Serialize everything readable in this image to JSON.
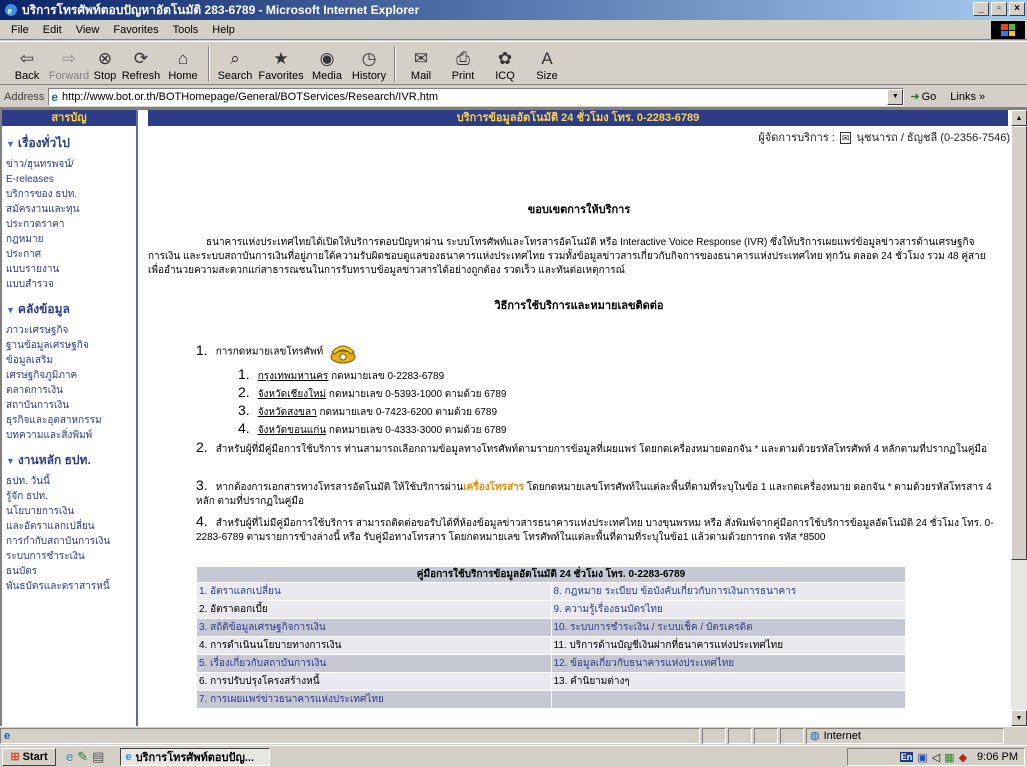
{
  "window": {
    "title": "บริการโทรศัพท์ตอบปัญหาอัตโนมัติ 283-6789 - Microsoft Internet Explorer"
  },
  "menu": [
    "File",
    "Edit",
    "View",
    "Favorites",
    "Tools",
    "Help"
  ],
  "toolbar": [
    {
      "label": "Back",
      "icon": "back-arrow-icon"
    },
    {
      "label": "Forward",
      "icon": "forward-arrow-icon"
    },
    {
      "label": "Stop",
      "icon": "stop-icon"
    },
    {
      "label": "Refresh",
      "icon": "refresh-icon"
    },
    {
      "label": "Home",
      "icon": "home-icon"
    },
    {
      "label": "Search",
      "icon": "search-icon"
    },
    {
      "label": "Favorites",
      "icon": "favorites-icon"
    },
    {
      "label": "Media",
      "icon": "media-icon"
    },
    {
      "label": "History",
      "icon": "history-icon"
    },
    {
      "label": "Mail",
      "icon": "mail-icon"
    },
    {
      "label": "Print",
      "icon": "print-icon"
    },
    {
      "label": "ICQ",
      "icon": "icq-icon"
    },
    {
      "label": "Size",
      "icon": "size-icon"
    }
  ],
  "address": {
    "label": "Address",
    "url": "http://www.bot.or.th/BOTHomepage/General/BOTServices/Research/IVR.htm",
    "go": "Go",
    "links": "Links »"
  },
  "sidebar": {
    "header": "สารบัญ",
    "sections": [
      {
        "title": "เรื่องทั่วไป",
        "items": [
          "ข่าว/ฮุนทรพจน์/",
          "E-releases",
          "บริการของ ธปท.",
          "สมัครงานและทุน",
          "ประกวดราคา",
          "กฎหมาย",
          "ประกาศ",
          "แบบรายงาน",
          "แบบสำรวจ"
        ]
      },
      {
        "title": "คลังข้อมูล",
        "items": [
          "ภาวะเศรษฐกิจ",
          "ฐานข้อมูลเศรษฐกิจ",
          "ข้อมูลเสริม",
          "เศรษฐกิจภูมิภาค",
          "ตลาดการเงิน",
          "สถาบันการเงิน",
          "ธุรกิจและอุตสาหกรรม",
          "บทความและสิ่งพิมพ์"
        ]
      },
      {
        "title": "งานหลัก ธปท.",
        "items": [
          "ธปท. วันนี้",
          "รู้จัก ธปท.",
          "นโยบายการเงิน",
          "และอัตราแลกเปลี่ยน",
          "การกำกับสถาบันการเงิน",
          "ระบบการชำระเงิน",
          "ธนบัตร",
          "พันธบัตรและตราสารหนี้"
        ]
      }
    ]
  },
  "main": {
    "header": "บริการข้อมูลอัตโนมัติ 24 ชั่วโมง โทร. 0-2283-6789",
    "manager_prefix": "ผู้จัดการบริการ :",
    "manager": "นุชนารถ / ธัญชลี (0-2356-7546)",
    "scope_title": "ขอบเขตการให้บริการ",
    "intro": "ธนาคารแห่งประเทศไทยได้เปิดให้บริการตอบปัญหาผ่าน ระบบโทรศัพท์และโทรสารอัตโนมัติ หรือ Interactive Voice Response (IVR) ซึ่งให้บริการเผยแพร่ข้อมูลข่าวสารด้านเศรษฐกิจ การเงิน และระบบสถาบันการเงินที่อยู่ภายใต้ความรับผิดชอบดูแลของธนาคารแห่งประเทศไทย รวมทั้งข้อมูลข่าวสารเกี่ยวกับกิจการของธนาคารแห่งประเทศไทย ทุกวัน ตลอด 24 ชั่วโมง รวม 48 คู่สาย เพื่ออำนวยความสะดวกแก่สาธารณชนในการรับทราบข้อมูลข่าวสารได้อย่างถูกต้อง รวดเร็ว และทันต่อเหตุการณ์",
    "method_title": "วิธีการใช้บริการและหมายเลขติดต่อ",
    "step1": {
      "num": "1.",
      "text": "การกดหมายเลขโทรศัพท์"
    },
    "regions": [
      {
        "num": "1.",
        "name": "กรุงเทพมหานคร",
        "detail": " กดหมายเลข 0-2283-6789"
      },
      {
        "num": "2.",
        "name": "จังหวัดเชียงใหม่",
        "detail": " กดหมายเลข 0-5393-1000 ตามด้วย 6789"
      },
      {
        "num": "3.",
        "name": "จังหวัดสงขลา",
        "detail": " กดหมายเลข 0-7423-6200 ตามด้วย 6789"
      },
      {
        "num": "4.",
        "name": "จังหวัดขอนแก่น",
        "detail": " กดหมายเลข 0-4333-3000 ตามด้วย 6789"
      }
    ],
    "step2": {
      "num": "2.",
      "text": "สำหรับผู้ที่มีคู่มือการใช้บริการ ท่านสามารถเลือกถามข้อมูลทางโทรศัพท์ตามรายการข้อมูลที่เผยแพร่ โดยกดเครื่องหมายดอกจัน * และตามด้วยรหัสโทรศัพท์ 4 หลักตามที่ปรากฏในคู่มือ"
    },
    "step3": {
      "num": "3.",
      "text_a": "หากต้องการเอกสารทางโทรสารอัตโนมัติ ให้ใช้บริการผ่าน",
      "highlight": "เครื่องโทรสาร",
      "text_b": " โดยกดหมายเลขโทรศัพท์ในแต่ละพื้นที่ตามที่ระบุในข้อ 1 และกดเครื่องหมาย ดอกจัน * ตามด้วยรหัสโทรสาร 4 หลัก ตามที่ปรากฏในคู่มือ"
    },
    "step4": {
      "num": "4.",
      "text": "สำหรับผู้ที่ไม่มีคู่มือการใช้บริการ สามารถติดต่อขอรับได้ที่ห้องข้อมูลข่าวสารธนาคารแห่งประเทศไทย บางขุนพรหม หรือ สั่งพิมพ์จากคู่มือการใช้บริการข้อมูลอัตโนมัติ 24 ชั่วโมง โทร. 0-2283-6789 ตามรายการข้างล่างนี้ หรือ รับคู่มือทางโทรสาร โดยกดหมายเลข โทรศัพท์ในแต่ละพื้นที่ตามที่ระบุในข้อ1 แล้วตามด้วยการกด รหัส *8500"
    }
  },
  "guide": {
    "title": "คู่มือการใช้บริการข้อมูลอัตโนมัติ 24 ชั่วโมง โทร. 0-2283-6789",
    "rows": [
      [
        "1. อัตราแลกเปลี่ยน",
        "8. กฎหมาย ระเบียบ ข้อบังคับเกี่ยวกับการเงินการธนาคาร"
      ],
      [
        "2. อัตราดอกเบี้ย",
        "9. ความรู้เรื่องธนบัตรไทย"
      ],
      [
        "3. สถิติข้อมูลเศรษฐกิจการเงิน",
        "10. ระบบการชำระเงิน / ระบบเช็ค / บัตรเครดิต"
      ],
      [
        "4. การดำเนินนโยบายทางการเงิน",
        "11. บริการด้านบัญชีเงินฝากที่ธนาคารแห่งประเทศไทย"
      ],
      [
        "5. เรื่องเกี่ยวกับสถาบันการเงิน",
        "12. ข้อมูลเกี่ยวกับธนาคารแห่งประเทศไทย"
      ],
      [
        "6. การปรับปรุงโครงสร้างหนี้",
        "13. คำนิยามต่างๆ"
      ],
      [
        "7. การเผยแพร่ข่าวธนาคารแห่งประเทศไทย",
        ""
      ]
    ]
  },
  "statusbar": {
    "zone": "Internet"
  },
  "taskbar": {
    "start": "Start",
    "task": "บริการโทรศัพท์ตอบปัญ...",
    "lang": "En",
    "clock": "9:06 PM"
  }
}
